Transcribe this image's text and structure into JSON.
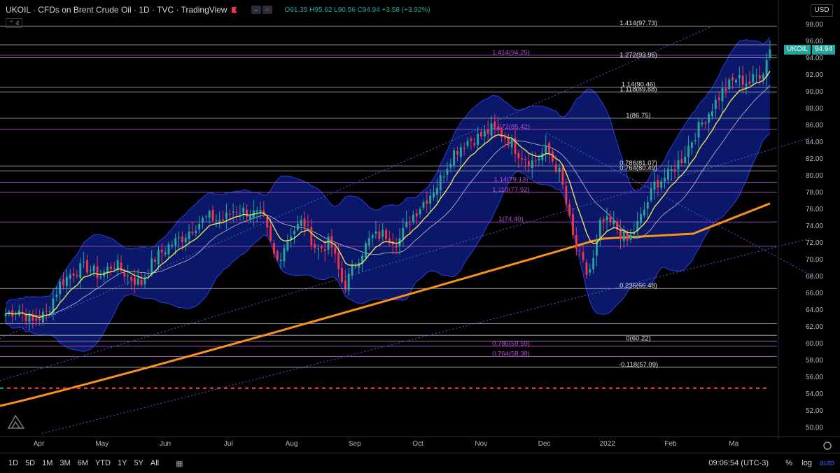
{
  "header": {
    "title": "UKOIL · CFDs on Brent Crude Oil · 1D · TVC · TradingView",
    "ohlc_o": "O91.35",
    "ohlc_h": "H95.62",
    "ohlc_l": "L90.56",
    "ohlc_c": "C94.94",
    "change": "+3.58 (+3.92%)",
    "collapse_label": "4",
    "currency": "USD"
  },
  "price_label": {
    "symbol": "UKOIL",
    "value": "94.94",
    "color": "#26a69a"
  },
  "bottom": {
    "ranges": [
      "1D",
      "5D",
      "1M",
      "3M",
      "6M",
      "YTD",
      "1Y",
      "5Y",
      "All"
    ],
    "time": "09:06:54 (UTC-3)",
    "pct": "%",
    "log": "log",
    "auto": "auto"
  },
  "colors": {
    "up": "#26a69a",
    "down": "#f23645",
    "ma200": "#f7931a",
    "ema": "#e8e35c",
    "bb_fill": "#0d1b7a",
    "bb_line": "#2c3fd6",
    "fib_purple": "#b14fcf"
  },
  "chart_data": {
    "type": "candlestick",
    "title": "UKOIL · CFDs on Brent Crude Oil · 1D · TVC · TradingView",
    "ylim": [
      49,
      99
    ],
    "yticks": [
      50,
      52,
      54,
      56,
      58,
      60,
      62,
      64,
      66,
      68,
      70,
      72,
      74,
      76,
      78,
      80,
      82,
      84,
      86,
      88,
      90,
      92,
      94,
      96,
      98
    ],
    "months": [
      {
        "label": "Apr",
        "x": 0.05
      },
      {
        "label": "May",
        "x": 0.145
      },
      {
        "label": "Jun",
        "x": 0.24
      },
      {
        "label": "Jul",
        "x": 0.335
      },
      {
        "label": "Aug",
        "x": 0.43
      },
      {
        "label": "Sep",
        "x": 0.525
      },
      {
        "label": "Oct",
        "x": 0.62
      },
      {
        "label": "Nov",
        "x": 0.715
      },
      {
        "label": "Dec",
        "x": 0.81
      },
      {
        "label": "2022",
        "x": 0.905
      },
      {
        "label": "Feb",
        "x": 1.0
      },
      {
        "label": "Ma",
        "x": 1.095
      }
    ],
    "close_path": [
      [
        0.0,
        63.5
      ],
      [
        0.02,
        64
      ],
      [
        0.04,
        62.5
      ],
      [
        0.06,
        63.5
      ],
      [
        0.08,
        67
      ],
      [
        0.1,
        68.5
      ],
      [
        0.12,
        69
      ],
      [
        0.14,
        68
      ],
      [
        0.16,
        69.5
      ],
      [
        0.18,
        68
      ],
      [
        0.2,
        67
      ],
      [
        0.22,
        70
      ],
      [
        0.24,
        71.5
      ],
      [
        0.26,
        72.5
      ],
      [
        0.28,
        74
      ],
      [
        0.3,
        75
      ],
      [
        0.32,
        74.5
      ],
      [
        0.34,
        76
      ],
      [
        0.36,
        75.5
      ],
      [
        0.38,
        75
      ],
      [
        0.4,
        69.5
      ],
      [
        0.42,
        73
      ],
      [
        0.44,
        74.5
      ],
      [
        0.46,
        71
      ],
      [
        0.48,
        72
      ],
      [
        0.5,
        66.5
      ],
      [
        0.52,
        70
      ],
      [
        0.54,
        72.5
      ],
      [
        0.56,
        73
      ],
      [
        0.58,
        72
      ],
      [
        0.6,
        75
      ],
      [
        0.62,
        77
      ],
      [
        0.64,
        79
      ],
      [
        0.66,
        82.5
      ],
      [
        0.68,
        84
      ],
      [
        0.7,
        84.5
      ],
      [
        0.72,
        85.5
      ],
      [
        0.74,
        84.5
      ],
      [
        0.76,
        82.5
      ],
      [
        0.78,
        81.5
      ],
      [
        0.8,
        83
      ],
      [
        0.82,
        80
      ],
      [
        0.84,
        72
      ],
      [
        0.86,
        68
      ],
      [
        0.87,
        70
      ],
      [
        0.88,
        74.5
      ],
      [
        0.9,
        74
      ],
      [
        0.92,
        72
      ],
      [
        0.94,
        75
      ],
      [
        0.96,
        79
      ],
      [
        0.98,
        80
      ],
      [
        1.0,
        82
      ],
      [
        1.02,
        85
      ],
      [
        1.04,
        87.5
      ],
      [
        1.06,
        90
      ],
      [
        1.08,
        91.5
      ],
      [
        1.1,
        91
      ],
      [
        1.12,
        92.5
      ],
      [
        1.13,
        94.94
      ]
    ],
    "annotations_right": [
      "1.414(97.73)",
      "1.272(93.96)",
      "1.14(90.46)",
      "1.118(89.88)",
      "1(86.75)",
      "0.786(81.07)",
      "0.764(80.49)",
      "0.236(66.48)",
      "0(60.22)",
      "-0.118(57.09)"
    ],
    "annotations_left": [
      "1.414(94.25)",
      "1.272(85.42)",
      "1.14(79.13)",
      "1.118(77.92)",
      "1(74.40)",
      "0.786(59.59)",
      "0.764(58.38)"
    ]
  }
}
